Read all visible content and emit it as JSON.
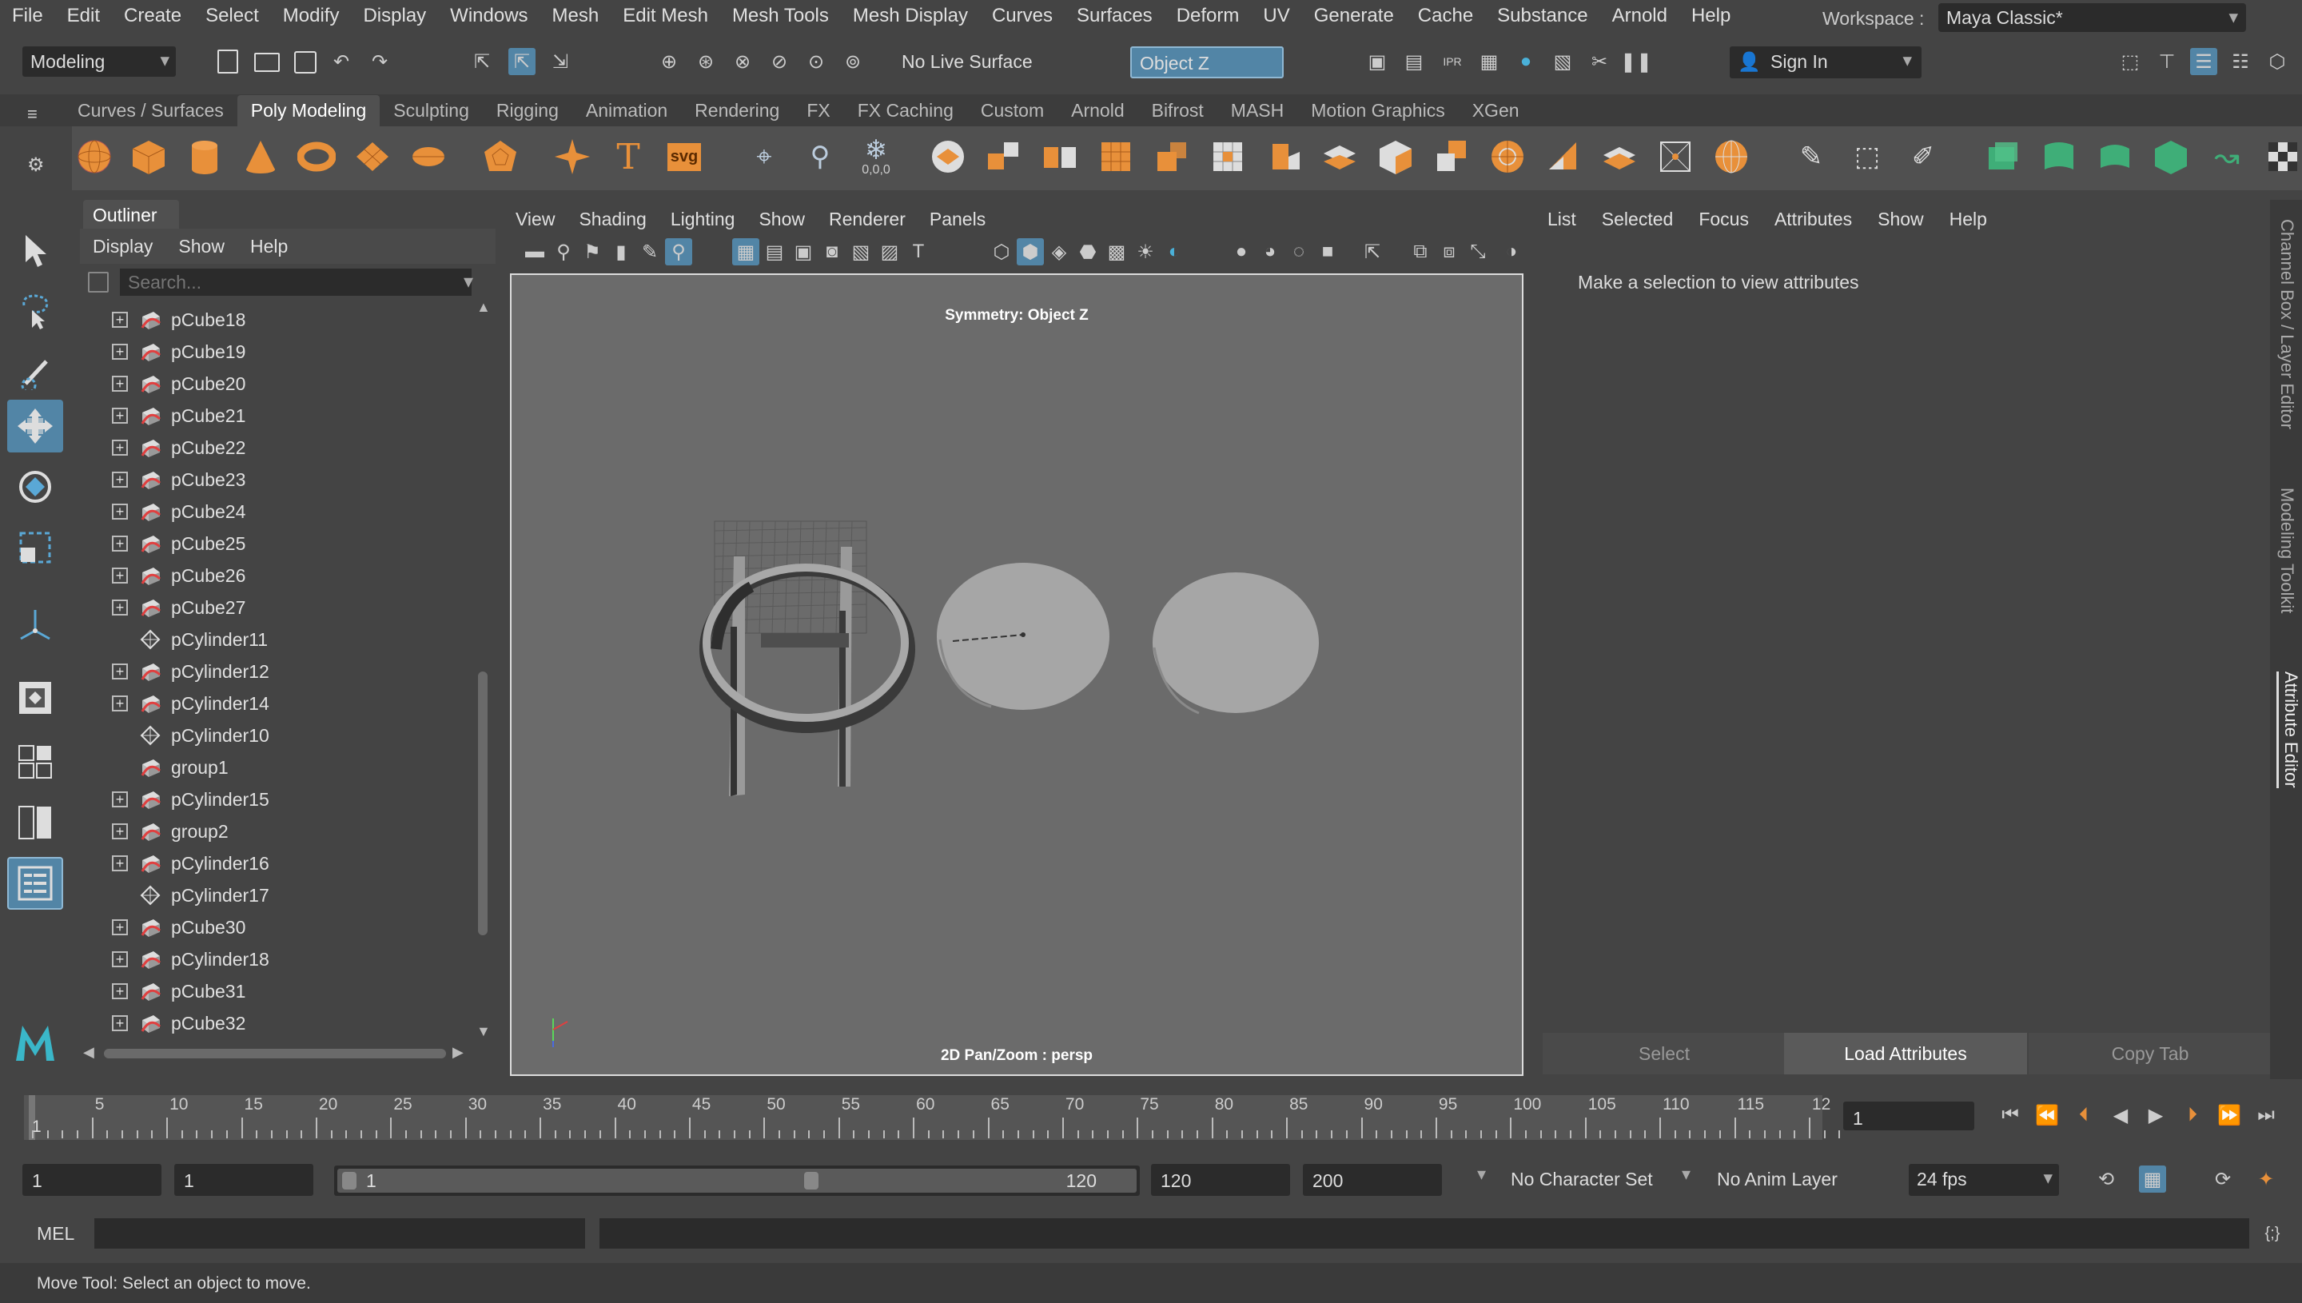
{
  "menubar": {
    "items": [
      "File",
      "Edit",
      "Create",
      "Select",
      "Modify",
      "Display",
      "Windows",
      "Mesh",
      "Edit Mesh",
      "Mesh Tools",
      "Mesh Display",
      "Curves",
      "Surfaces",
      "Deform",
      "UV",
      "Generate",
      "Cache",
      "Substance",
      "Arnold",
      "Help"
    ],
    "workspace_label": "Workspace :",
    "workspace_value": "Maya Classic*"
  },
  "statusline": {
    "mode": "Modeling",
    "live_surface": "No Live Surface",
    "symmetry": "Object Z",
    "sign_in": "Sign In"
  },
  "shelf": {
    "tabs": [
      "Curves / Surfaces",
      "Poly Modeling",
      "Sculpting",
      "Rigging",
      "Animation",
      "Rendering",
      "FX",
      "FX Caching",
      "Custom",
      "Arnold",
      "Bifrost",
      "MASH",
      "Motion Graphics",
      "XGen"
    ],
    "active_tab": "Poly Modeling",
    "svg_label": "svg",
    "zero_label": "0,0,0"
  },
  "outliner": {
    "title": "Outliner",
    "menu": [
      "Display",
      "Show",
      "Help"
    ],
    "search_placeholder": "Search...",
    "items": [
      {
        "name": "pCube18",
        "kind": "mesh",
        "expandable": true
      },
      {
        "name": "pCube19",
        "kind": "mesh",
        "expandable": true
      },
      {
        "name": "pCube20",
        "kind": "mesh",
        "expandable": true
      },
      {
        "name": "pCube21",
        "kind": "mesh",
        "expandable": true
      },
      {
        "name": "pCube22",
        "kind": "mesh",
        "expandable": true
      },
      {
        "name": "pCube23",
        "kind": "mesh",
        "expandable": true
      },
      {
        "name": "pCube24",
        "kind": "mesh",
        "expandable": true
      },
      {
        "name": "pCube25",
        "kind": "mesh",
        "expandable": true
      },
      {
        "name": "pCube26",
        "kind": "mesh",
        "expandable": true
      },
      {
        "name": "pCube27",
        "kind": "mesh",
        "expandable": true
      },
      {
        "name": "pCylinder11",
        "kind": "group",
        "expandable": false
      },
      {
        "name": "pCylinder12",
        "kind": "mesh",
        "expandable": true
      },
      {
        "name": "pCylinder14",
        "kind": "mesh",
        "expandable": true
      },
      {
        "name": "pCylinder10",
        "kind": "group",
        "expandable": false
      },
      {
        "name": "group1",
        "kind": "mesh",
        "expandable": false
      },
      {
        "name": "pCylinder15",
        "kind": "mesh",
        "expandable": true
      },
      {
        "name": "group2",
        "kind": "mesh",
        "expandable": true
      },
      {
        "name": "pCylinder16",
        "kind": "mesh",
        "expandable": true
      },
      {
        "name": "pCylinder17",
        "kind": "group",
        "expandable": false
      },
      {
        "name": "pCube30",
        "kind": "mesh",
        "expandable": true
      },
      {
        "name": "pCylinder18",
        "kind": "mesh",
        "expandable": true
      },
      {
        "name": "pCube31",
        "kind": "mesh",
        "expandable": true
      },
      {
        "name": "pCube32",
        "kind": "mesh",
        "expandable": true
      }
    ]
  },
  "viewport": {
    "menu": [
      "View",
      "Shading",
      "Lighting",
      "Show",
      "Renderer",
      "Panels"
    ],
    "symmetry_label": "Symmetry: Object Z",
    "camera_label": "2D Pan/Zoom : persp"
  },
  "attributes": {
    "menu": [
      "List",
      "Selected",
      "Focus",
      "Attributes",
      "Show",
      "Help"
    ],
    "message": "Make a selection to view attributes",
    "buttons": [
      "Select",
      "Load Attributes",
      "Copy Tab"
    ]
  },
  "side_tabs": [
    "Channel Box / Layer Editor",
    "Modeling Toolkit",
    "Attribute Editor"
  ],
  "timeline": {
    "ticks": [
      "5",
      "10",
      "15",
      "20",
      "25",
      "30",
      "35",
      "40",
      "45",
      "50",
      "55",
      "60",
      "65",
      "70",
      "75",
      "80",
      "85",
      "90",
      "95",
      "100",
      "105",
      "110",
      "115",
      "12"
    ],
    "current_frame_marker": "1",
    "current_frame": "1"
  },
  "range": {
    "start": "1",
    "playback_start": "1",
    "slider_start": "1",
    "slider_end": "120",
    "playback_end": "120",
    "end": "200",
    "character_set": "No Character Set",
    "anim_layer": "No Anim Layer",
    "fps": "24 fps"
  },
  "command": {
    "language": "MEL"
  },
  "help_line": "Move Tool: Select an object to move."
}
